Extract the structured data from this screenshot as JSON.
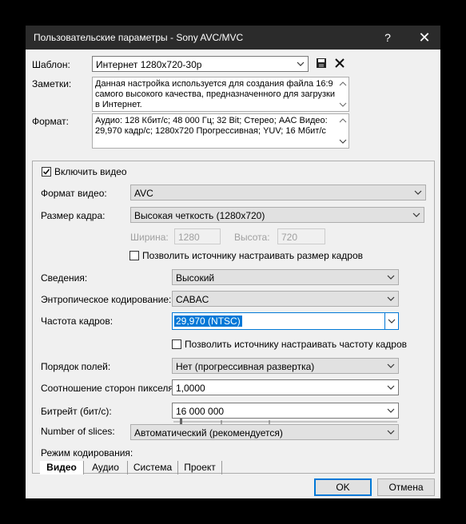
{
  "window": {
    "title": "Пользовательские параметры - Sony AVC/MVC",
    "help_label": "?",
    "close_label": "✕"
  },
  "template": {
    "label": "Шаблон:",
    "value": "Интернет 1280x720-30p",
    "save_icon": "save-icon",
    "delete_icon": "delete-icon"
  },
  "notes": {
    "label": "Заметки:",
    "text": "Данная настройка используется для создания файла 16:9 самого высокого качества, предназначенного для загрузки в Интернет."
  },
  "format": {
    "label": "Формат:",
    "text": "Аудио: 128 Кбит/с; 48 000 Гц; 32 Bit; Стерео; AAC Видео: 29,970 кадр/с; 1280x720 Прогрессивная; YUV; 16 Мбит/с"
  },
  "video": {
    "include_label": "Включить видео",
    "include_checked": true,
    "video_format_label": "Формат видео:",
    "video_format_value": "AVC",
    "frame_size_label": "Размер кадра:",
    "frame_size_value": "Высокая четкость (1280x720)",
    "width_label": "Ширина:",
    "width_value": "1280",
    "height_label": "Высота:",
    "height_value": "720",
    "allow_frame_size_label": "Позволить источнику настраивать размер кадров",
    "allow_frame_size_checked": false,
    "profile_label": "Сведения:",
    "profile_value": "Высокий",
    "entropy_label": "Энтропическое кодирование:",
    "entropy_value": "CABAC",
    "frame_rate_label": "Частота кадров:",
    "frame_rate_value": "29,970 (NTSC)",
    "allow_frame_rate_label": "Позволить источнику настраивать частоту кадров",
    "allow_frame_rate_checked": false,
    "field_order_label": "Порядок полей:",
    "field_order_value": "Нет (прогрессивная развертка)",
    "pixel_aspect_label": "Соотношение сторон пикселя:",
    "pixel_aspect_value": "1,0000",
    "bitrate_label": "Битрейт (бит/с):",
    "bitrate_value": "16 000 000",
    "slices_label": "Number of slices:",
    "slices_value": "Автоматический (рекомендуется)",
    "encode_mode_label": "Режим кодирования:"
  },
  "tabs": [
    "Видео",
    "Аудио",
    "Система",
    "Проект"
  ],
  "buttons": {
    "ok": "OK",
    "cancel": "Отмена"
  },
  "colors": {
    "titlebar": "#2b2b2b",
    "accent": "#0078d7"
  }
}
